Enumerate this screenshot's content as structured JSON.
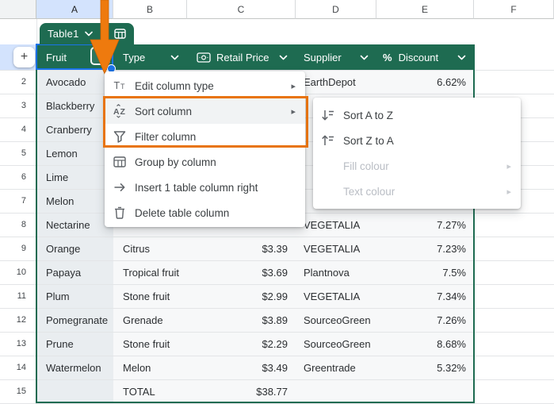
{
  "sheet": {
    "column_headers": [
      "A",
      "B",
      "C",
      "D",
      "E",
      "F"
    ],
    "selected_column": "A",
    "rows": [
      {
        "n": "2",
        "fruit": "Avocado",
        "type": "",
        "price": "",
        "supplier": "EarthDepot",
        "discount": "6.62%"
      },
      {
        "n": "3",
        "fruit": "Blackberry",
        "type": "",
        "price": "",
        "supplier": "",
        "discount": ""
      },
      {
        "n": "4",
        "fruit": "Cranberry",
        "type": "",
        "price": "",
        "supplier": "",
        "discount": ""
      },
      {
        "n": "5",
        "fruit": "Lemon",
        "type": "",
        "price": "",
        "supplier": "",
        "discount": ""
      },
      {
        "n": "6",
        "fruit": "Lime",
        "type": "",
        "price": "",
        "supplier": "",
        "discount": ""
      },
      {
        "n": "7",
        "fruit": "Melon",
        "type": "",
        "price": "",
        "supplier": "",
        "discount": ""
      },
      {
        "n": "8",
        "fruit": "Nectarine",
        "type": "",
        "price": "",
        "supplier": "VEGETALIA",
        "discount": "7.27%"
      },
      {
        "n": "9",
        "fruit": "Orange",
        "type": "Citrus",
        "price": "$3.39",
        "supplier": "VEGETALIA",
        "discount": "7.23%"
      },
      {
        "n": "10",
        "fruit": "Papaya",
        "type": "Tropical fruit",
        "price": "$3.69",
        "supplier": "Plantnova",
        "discount": "7.5%"
      },
      {
        "n": "11",
        "fruit": "Plum",
        "type": "Stone fruit",
        "price": "$2.99",
        "supplier": "VEGETALIA",
        "discount": "7.34%"
      },
      {
        "n": "12",
        "fruit": "Pomegranate",
        "type": "Grenade",
        "price": "$3.89",
        "supplier": "SourceoGreen",
        "discount": "7.26%"
      },
      {
        "n": "13",
        "fruit": "Prune",
        "type": "Stone fruit",
        "price": "$2.29",
        "supplier": "SourceoGreen",
        "discount": "8.68%"
      },
      {
        "n": "14",
        "fruit": "Watermelon",
        "type": "Melon",
        "price": "$3.49",
        "supplier": "Greentrade",
        "discount": "5.32%"
      },
      {
        "n": "15",
        "fruit": "",
        "type": "TOTAL",
        "price": "$38.77",
        "supplier": "",
        "discount": ""
      }
    ]
  },
  "table": {
    "chip_label": "Table1",
    "columns": [
      {
        "label": "Fruit"
      },
      {
        "label": "Type"
      },
      {
        "label": "Retail Price",
        "type_icon": "banknote"
      },
      {
        "label": "Supplier"
      },
      {
        "label": "Discount",
        "type_icon": "percent"
      }
    ],
    "percent_glyph": "%"
  },
  "controls": {
    "add_button_label": "+"
  },
  "menu": {
    "items": [
      {
        "label": "Edit column type",
        "icon": "edit-column-type",
        "has_submenu": true
      },
      {
        "label": "Sort column",
        "icon": "sort-column",
        "has_submenu": true,
        "state": "hover"
      },
      {
        "label": "Filter column",
        "icon": "filter-column"
      },
      {
        "label": "Group by column",
        "icon": "group-by-column"
      },
      {
        "label": "Insert 1 table column right",
        "icon": "insert-column-right"
      },
      {
        "label": "Delete table column",
        "icon": "delete-column"
      }
    ],
    "submenu_arrow": "▸"
  },
  "submenu": {
    "items": [
      {
        "label": "Sort A to Z",
        "icon": "sort-a-to-z",
        "disabled": false
      },
      {
        "label": "Sort Z to A",
        "icon": "sort-z-to-a",
        "disabled": false
      },
      {
        "label": "Fill colour",
        "disabled": true,
        "has_submenu": true
      },
      {
        "label": "Text colour",
        "disabled": true,
        "has_submenu": true
      }
    ]
  },
  "colors": {
    "table_green": "#1e6b51",
    "selection_blue": "#1a73e8",
    "selected_header_blue": "#d3e3fd",
    "annotation_orange": "#e8740e",
    "row_bg": "#f7f8f9",
    "selected_col_bg": "#e9edf0"
  }
}
